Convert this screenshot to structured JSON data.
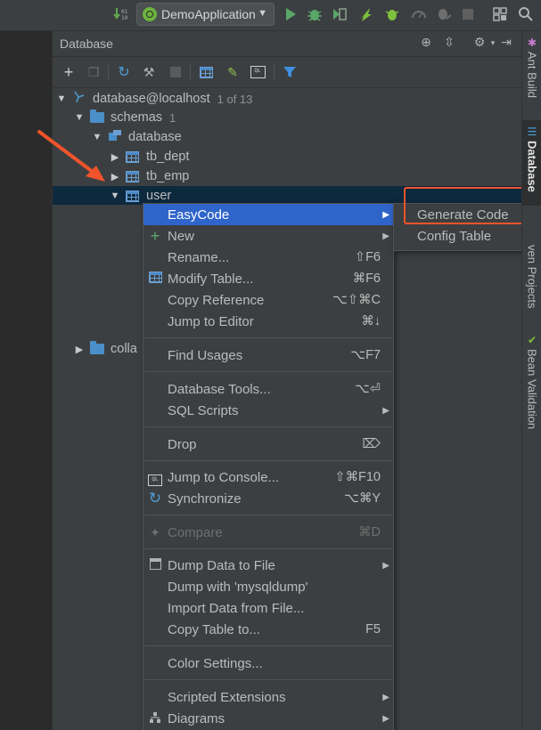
{
  "toolbar": {
    "run_config": "DemoApplication",
    "icons": [
      "vcs-update-icon",
      "spring-config-icon",
      "run-icon",
      "debug-icon",
      "coverage-icon",
      "jrebel-run-icon",
      "jrebel-debug-icon",
      "profile-icon",
      "attach-icon",
      "stop-icon",
      "project-structure-icon",
      "search-icon"
    ]
  },
  "db_panel": {
    "title": "Database",
    "header_icons": [
      "globe-icon",
      "collapse-icon",
      "gear-icon",
      "hide-icon"
    ],
    "toolbar_icons": [
      "add-icon",
      "duplicate-icon",
      "refresh-icon",
      "properties-icon",
      "stop-icon",
      "table-editor-icon",
      "edit-source-icon",
      "console-icon",
      "filter-icon"
    ]
  },
  "tree": {
    "root": {
      "label": "database@localhost",
      "meta": "1 of 13"
    },
    "schemas": {
      "label": "schemas",
      "count": "1"
    },
    "schema": {
      "label": "database"
    },
    "tables": [
      "tb_dept",
      "tb_emp",
      "user"
    ],
    "collations": "colla"
  },
  "context_menu": {
    "items": [
      {
        "label": "EasyCode",
        "shortcut": "",
        "submenu": true,
        "selected": true
      },
      {
        "label": "New",
        "shortcut": "",
        "submenu": true,
        "icon": "plus-icon"
      },
      {
        "label": "Rename...",
        "shortcut": "⇧F6"
      },
      {
        "label": "Modify Table...",
        "shortcut": "⌘F6",
        "icon": "table-icon"
      },
      {
        "label": "Copy Reference",
        "shortcut": "⌥⇧⌘C"
      },
      {
        "label": "Jump to Editor",
        "shortcut": "⌘↓"
      },
      {
        "label": "Find Usages",
        "shortcut": "⌥F7"
      },
      {
        "label": "Database Tools...",
        "shortcut": "⌥⏎"
      },
      {
        "label": "SQL Scripts",
        "shortcut": "",
        "submenu": true
      },
      {
        "label": "Drop",
        "shortcut": "⌦"
      },
      {
        "label": "Jump to Console...",
        "shortcut": "⇧⌘F10",
        "icon": "console-icon"
      },
      {
        "label": "Synchronize",
        "shortcut": "⌥⌘Y",
        "icon": "sync-icon"
      },
      {
        "label": "Compare",
        "shortcut": "⌘D",
        "disabled": true,
        "icon": "compare-icon"
      },
      {
        "label": "Dump Data to File",
        "shortcut": "",
        "submenu": true,
        "icon": "dump-icon"
      },
      {
        "label": "Dump with 'mysqldump'",
        "shortcut": ""
      },
      {
        "label": "Import Data from File...",
        "shortcut": ""
      },
      {
        "label": "Copy Table to...",
        "shortcut": "F5"
      },
      {
        "label": "Color Settings...",
        "shortcut": ""
      },
      {
        "label": "Scripted Extensions",
        "shortcut": "",
        "submenu": true
      },
      {
        "label": "Diagrams",
        "shortcut": "",
        "submenu": true,
        "icon": "diagram-icon"
      }
    ]
  },
  "submenu": {
    "items": [
      "Generate Code",
      "Config Table"
    ]
  },
  "right_strip": {
    "tabs": [
      "Ant Build",
      "Database",
      "ven Projects",
      "Bean Validation"
    ]
  },
  "colors": {
    "selection": "#2f65ca",
    "highlight_box": "#f0542b",
    "tree_selected_row": "#0d293e"
  }
}
